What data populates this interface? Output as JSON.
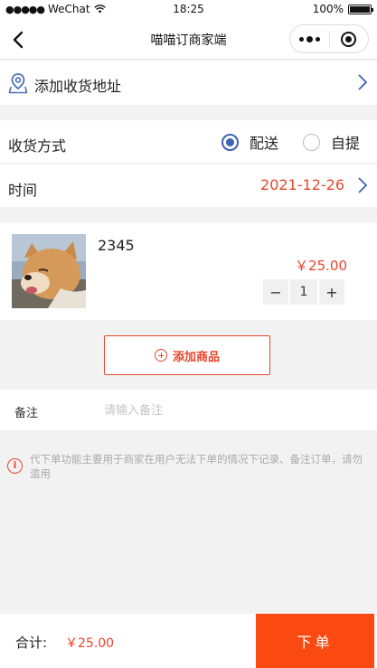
{
  "status_bar": {
    "carrier": "WeChat",
    "time": "18:25",
    "battery": "100%"
  },
  "nav": {
    "title": "喵喵订商家端"
  },
  "address": {
    "label": "添加收货地址"
  },
  "delivery": {
    "label": "收货方式",
    "options": [
      "配送",
      "自提"
    ],
    "selected": "配送"
  },
  "time_row": {
    "label": "时间",
    "value": "2021-12-26"
  },
  "product": {
    "name": "2345",
    "price": "￥25.00",
    "quantity": "1",
    "minus": "−",
    "plus": "+"
  },
  "add_product": {
    "label": "添加商品"
  },
  "remark": {
    "label": "备注",
    "placeholder": "请输入备注"
  },
  "notice": {
    "icon": "i",
    "text": "代下单功能主要用于商家在用户无法下单的情况下记录、备注订单，请勿滥用"
  },
  "footer": {
    "total_label": "合计:",
    "total_value": "￥25.00",
    "submit_label": "下单"
  },
  "colors": {
    "accent": "#e8452c",
    "primary_button": "#fa4a12",
    "radio_blue": "#3d62b6"
  }
}
